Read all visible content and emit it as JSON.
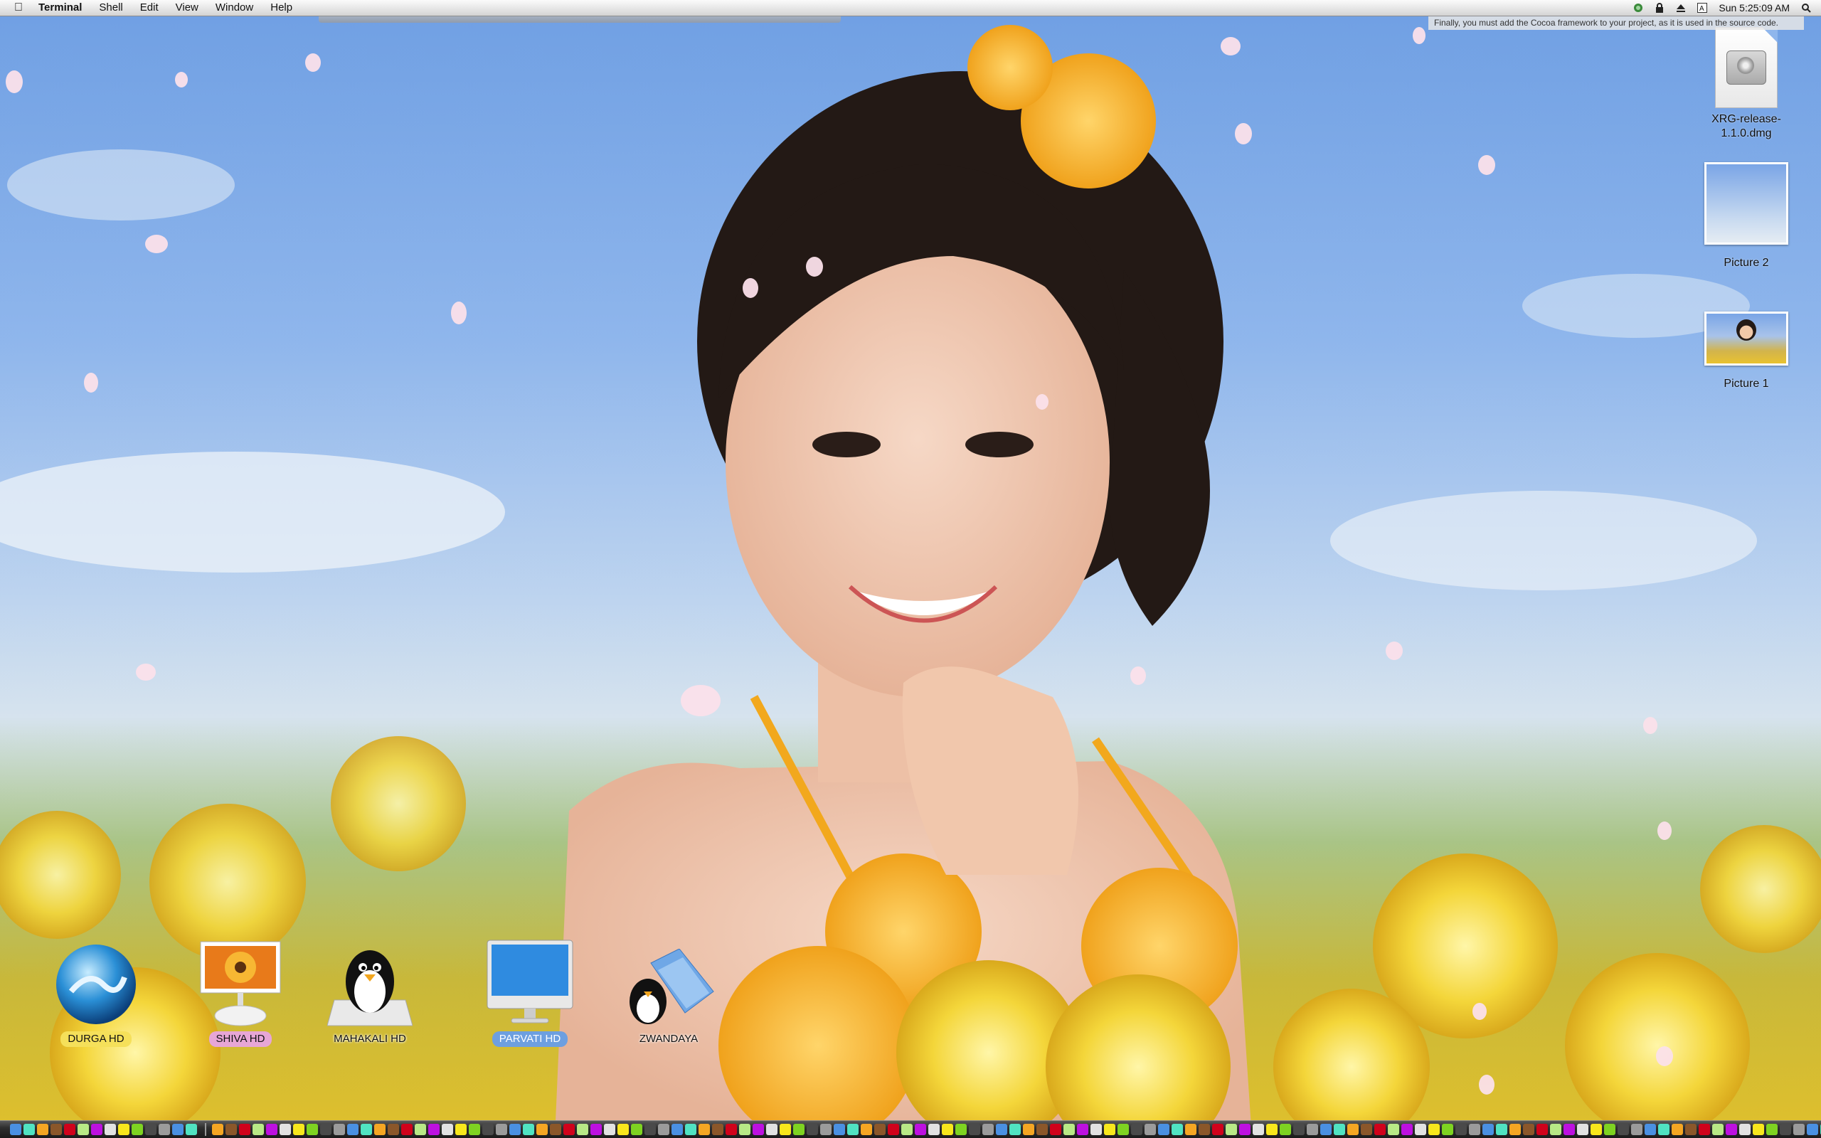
{
  "menubar": {
    "app_name": "Terminal",
    "menus": [
      "Shell",
      "Edit",
      "View",
      "Window",
      "Help"
    ],
    "clock": "Sun 5:25:09 AM",
    "status_icons": [
      "xrg-icon",
      "lock-icon",
      "eject-icon",
      "input-menu-icon",
      "spotlight-icon"
    ]
  },
  "notice_text": "Finally, you must add the Cocoa framework to your project, as it is used in the source code.",
  "desktop_icons": [
    {
      "label": "XRG-release-1.1.0.dmg",
      "kind": "disk-image"
    },
    {
      "label": "Picture 2",
      "kind": "screenshot"
    },
    {
      "label": "Picture 1",
      "kind": "screenshot"
    }
  ],
  "disks": [
    {
      "label": "DURGA HD",
      "icon": "blue-sphere-icon",
      "label_color": "#f5e05a"
    },
    {
      "label": "SHIVA HD",
      "icon": "imac-flower-icon",
      "label_color": "#e7a6d6"
    },
    {
      "label": "MAHAKALI HD",
      "icon": "penguin-icon",
      "label_color": ""
    },
    {
      "label": "PARVATI HD",
      "icon": "imac-display-icon",
      "label_color": "#6d9fe0"
    },
    {
      "label": "ZWANDAYA",
      "icon": "penguin-folder-icon",
      "label_color": ""
    }
  ],
  "dock": {
    "icon_count": 180
  }
}
